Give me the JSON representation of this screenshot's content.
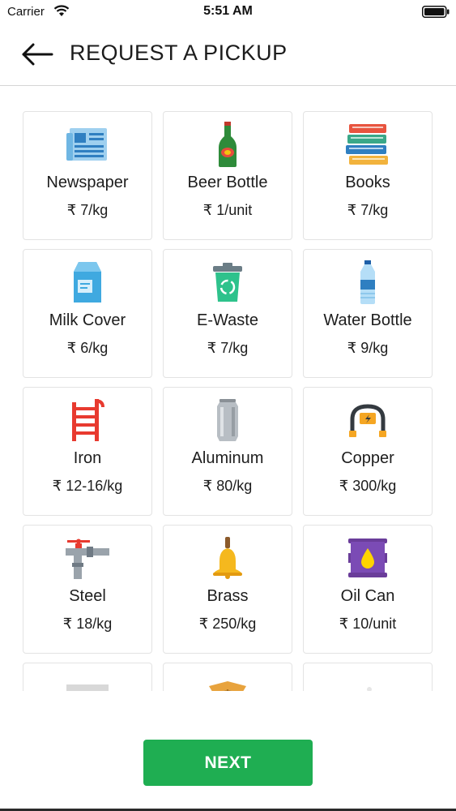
{
  "status_bar": {
    "carrier": "Carrier",
    "time": "5:51 AM"
  },
  "header": {
    "title": "REQUEST A PICKUP",
    "back_icon": "arrow-left-icon"
  },
  "items": [
    {
      "name": "Newspaper",
      "price": "₹ 7/kg",
      "icon": "newspaper-icon"
    },
    {
      "name": "Beer Bottle",
      "price": "₹ 1/unit",
      "icon": "beer-bottle-icon"
    },
    {
      "name": "Books",
      "price": "₹ 7/kg",
      "icon": "books-icon"
    },
    {
      "name": "Milk Cover",
      "price": "₹ 6/kg",
      "icon": "milk-carton-icon"
    },
    {
      "name": "E-Waste",
      "price": "₹ 7/kg",
      "icon": "recycle-bin-icon"
    },
    {
      "name": "Water Bottle",
      "price": "₹ 9/kg",
      "icon": "water-bottle-icon"
    },
    {
      "name": "Iron",
      "price": "₹ 12-16/kg",
      "icon": "ladder-icon"
    },
    {
      "name": "Aluminum",
      "price": "₹ 80/kg",
      "icon": "can-icon"
    },
    {
      "name": "Copper",
      "price": "₹ 300/kg",
      "icon": "cable-icon"
    },
    {
      "name": "Steel",
      "price": "₹ 18/kg",
      "icon": "pipe-valve-icon"
    },
    {
      "name": "Brass",
      "price": "₹ 250/kg",
      "icon": "bell-icon"
    },
    {
      "name": "Oil Can",
      "price": "₹ 10/unit",
      "icon": "oil-drum-icon"
    },
    {
      "name": "",
      "price": "",
      "icon": "grey-sheet-icon"
    },
    {
      "name": "",
      "price": "",
      "icon": "cardboard-box-icon"
    },
    {
      "name": "",
      "price": "",
      "icon": "plastic-icon"
    }
  ],
  "footer": {
    "next_label": "NEXT"
  },
  "colors": {
    "accent": "#1fae52",
    "card_border": "#e3e3e3"
  }
}
